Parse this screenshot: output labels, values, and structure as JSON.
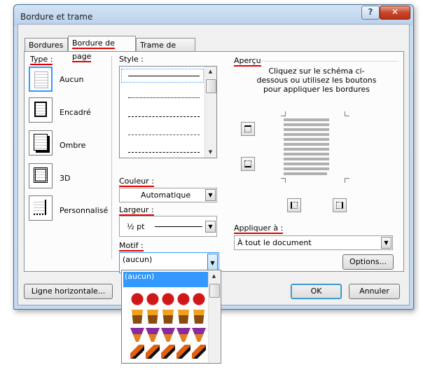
{
  "window": {
    "title": "Bordure et trame",
    "help_label": "?",
    "close_label": "✕"
  },
  "tabs": [
    {
      "label": "Bordures",
      "active": false
    },
    {
      "label": "Bordure de page",
      "active": true
    },
    {
      "label": "Trame de fond",
      "active": false
    }
  ],
  "type_section": {
    "label": "Type :",
    "presets": [
      {
        "label": "Aucun",
        "selected": true
      },
      {
        "label": "Encadré",
        "selected": false
      },
      {
        "label": "Ombre",
        "selected": false
      },
      {
        "label": "3D",
        "selected": false
      },
      {
        "label": "Personnalisé",
        "selected": false
      }
    ]
  },
  "style_section": {
    "label": "Style :"
  },
  "couleur": {
    "label": "Couleur :",
    "value": "Automatique"
  },
  "largeur": {
    "label": "Largeur :",
    "value": "½ pt"
  },
  "motif": {
    "label": "Motif :",
    "value": "(aucun)",
    "dropdown_selected": "(aucun)"
  },
  "apercu": {
    "label": "Aperçu",
    "hint": "Cliquez sur le schéma ci-dessous ou utilisez les boutons pour appliquer les bordures"
  },
  "appliquer": {
    "label": "Appliquer à :",
    "value": "À tout le document"
  },
  "buttons": {
    "options": "Options...",
    "horizontal_line": "Ligne horizontale...",
    "ok": "OK",
    "cancel": "Annuler"
  },
  "colors": {
    "accent": "#3399ff",
    "underline": "#e00000",
    "title_bar": "#c6d9ee"
  }
}
